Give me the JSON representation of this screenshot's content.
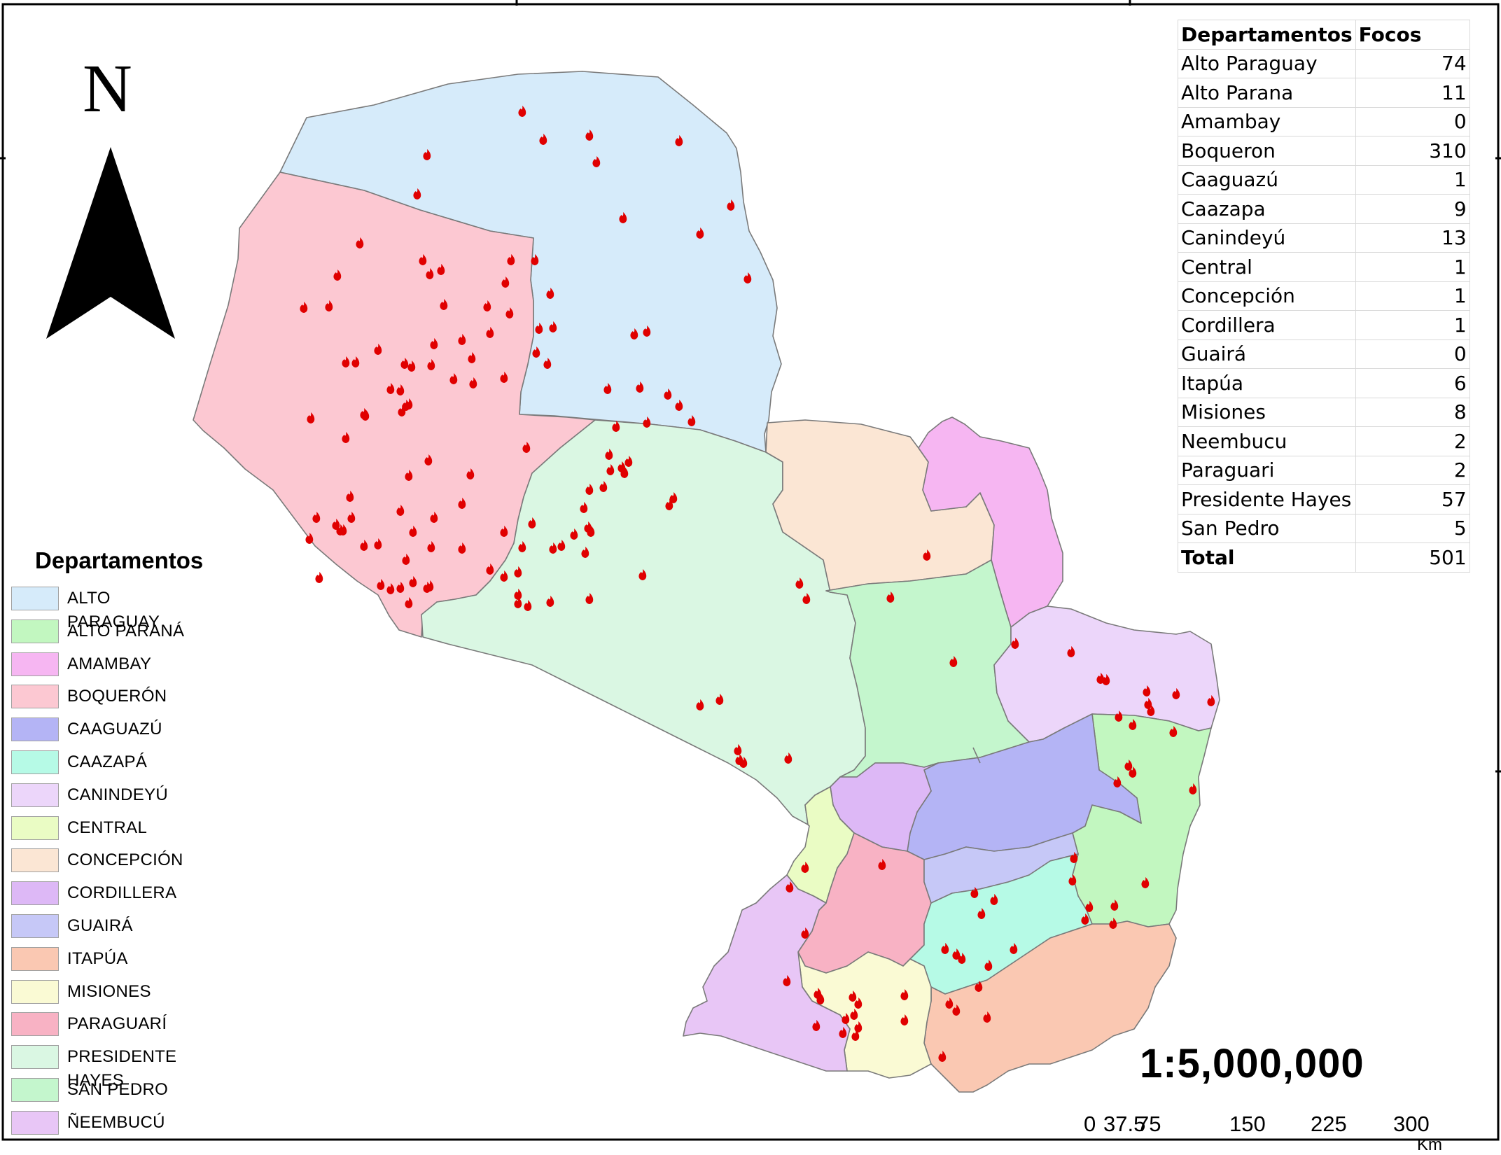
{
  "north_arrow": {
    "letter": "N",
    "icon": "north-arrow-icon"
  },
  "table": {
    "headers": [
      "Departamentos",
      "Focos"
    ],
    "rows": [
      {
        "name": "Alto Paraguay",
        "focos": "74"
      },
      {
        "name": "Alto Parana",
        "focos": "11"
      },
      {
        "name": "Amambay",
        "focos": "0"
      },
      {
        "name": "Boqueron",
        "focos": "310"
      },
      {
        "name": "Caaguazú",
        "focos": "1"
      },
      {
        "name": "Caazapa",
        "focos": "9"
      },
      {
        "name": "Canindeyú",
        "focos": "13"
      },
      {
        "name": "Central",
        "focos": "1"
      },
      {
        "name": "Concepción",
        "focos": "1"
      },
      {
        "name": "Cordillera",
        "focos": "1"
      },
      {
        "name": "Guairá",
        "focos": "0"
      },
      {
        "name": "Itapúa",
        "focos": "6"
      },
      {
        "name": "Misiones",
        "focos": "8"
      },
      {
        "name": "Neembucu",
        "focos": "2"
      },
      {
        "name": "Paraguari",
        "focos": "2"
      },
      {
        "name": "Presidente Hayes",
        "focos": "57"
      },
      {
        "name": "San Pedro",
        "focos": "5"
      }
    ],
    "total_label": "Total",
    "total_value": "501"
  },
  "legend": {
    "title": "Departamentos",
    "items": [
      {
        "label": "ALTO PARAGUAY",
        "color": "#d6ebfa"
      },
      {
        "label": "ALTO PARANÁ",
        "color": "#c2f7c0"
      },
      {
        "label": "AMAMBAY",
        "color": "#f6b6f2"
      },
      {
        "label": "BOQUERÓN",
        "color": "#fcc8d2"
      },
      {
        "label": "CAAGUAZÚ",
        "color": "#b4b4f5"
      },
      {
        "label": "CAAZAPÁ",
        "color": "#b6fae6"
      },
      {
        "label": "CANINDEYÚ",
        "color": "#ecd6fa"
      },
      {
        "label": "CENTRAL",
        "color": "#eafcc4"
      },
      {
        "label": "CONCEPCIÓN",
        "color": "#fbe6d4"
      },
      {
        "label": "CORDILLERA",
        "color": "#ddb8f6"
      },
      {
        "label": "GUAIRÁ",
        "color": "#c6c8f7"
      },
      {
        "label": "ITAPÚA",
        "color": "#fac8b2"
      },
      {
        "label": "MISIONES",
        "color": "#fafad4"
      },
      {
        "label": "PARAGUARÍ",
        "color": "#f8b2c4"
      },
      {
        "label": "PRESIDENTE HAYES",
        "color": "#daf7e3"
      },
      {
        "label": "SAN PEDRO",
        "color": "#c4f6cd"
      },
      {
        "label": "ÑEEMBUCÚ",
        "color": "#e8c6f6"
      }
    ]
  },
  "scale": {
    "ratio": "1:5,000,000",
    "ticks": [
      "0",
      "37.5",
      "75",
      "150",
      "225",
      "300"
    ],
    "unit": "Km"
  },
  "fire_icon": "fire-icon",
  "fire_color": "#e00000"
}
